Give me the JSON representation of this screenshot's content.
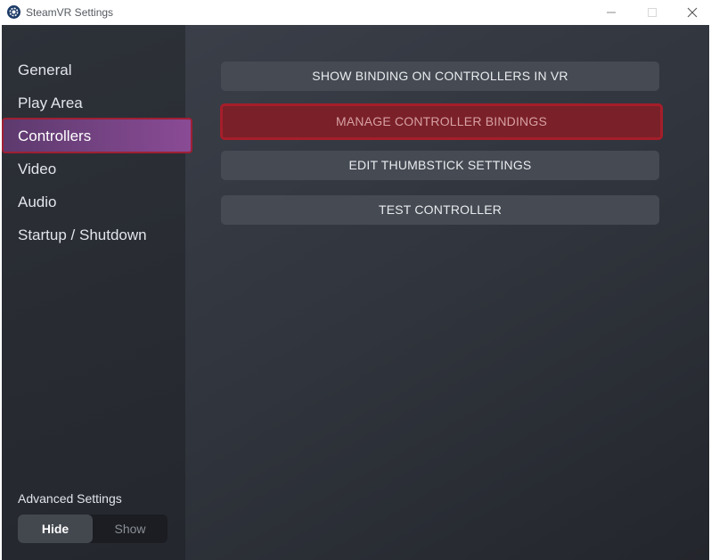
{
  "window": {
    "title": "SteamVR Settings"
  },
  "sidebar": {
    "items": [
      {
        "label": "General"
      },
      {
        "label": "Play Area"
      },
      {
        "label": "Controllers"
      },
      {
        "label": "Video"
      },
      {
        "label": "Audio"
      },
      {
        "label": "Startup / Shutdown"
      }
    ],
    "selected": "Controllers",
    "advanced": {
      "label": "Advanced Settings",
      "options": [
        "Hide",
        "Show"
      ],
      "selected": "Hide"
    }
  },
  "main": {
    "buttons": [
      {
        "label": "SHOW BINDING ON CONTROLLERS IN VR"
      },
      {
        "label": "MANAGE CONTROLLER BINDINGS"
      },
      {
        "label": "EDIT THUMBSTICK SETTINGS"
      },
      {
        "label": "TEST CONTROLLER"
      }
    ]
  },
  "colors": {
    "selected_nav": "#8a4b95",
    "highlight_border": "#a51e2a",
    "button_bg": "#454a53"
  },
  "icons": {
    "app": "steamvr-gear-icon",
    "minimize": "minimize-icon",
    "maximize": "maximize-icon",
    "close": "close-icon"
  }
}
